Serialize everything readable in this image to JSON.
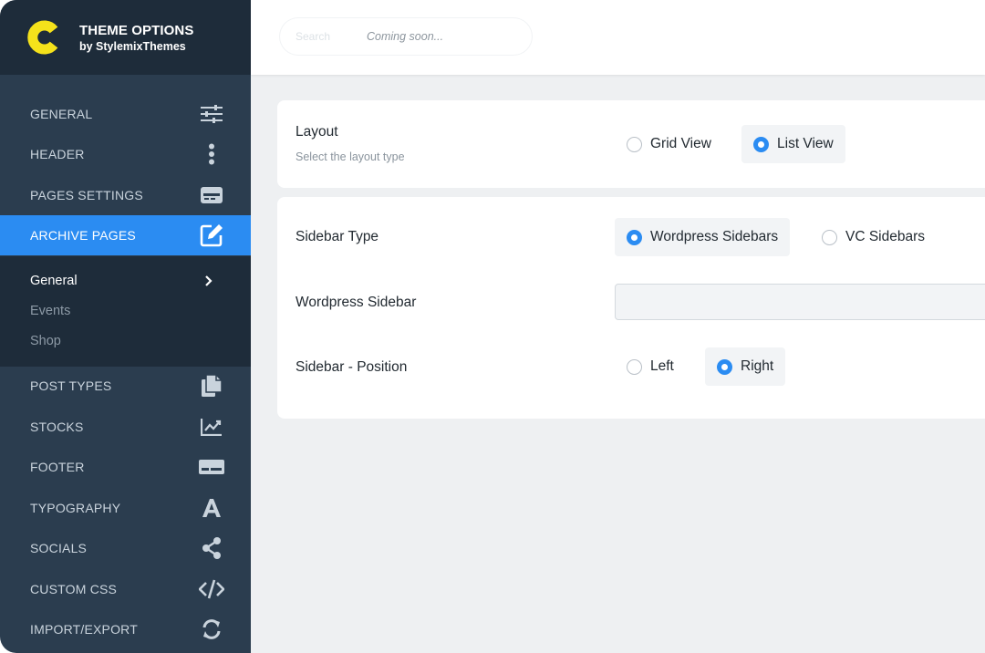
{
  "brand": {
    "title": "THEME OPTIONS",
    "subtitle": "by StylemixThemes",
    "logo_letter": "C",
    "logo_color": "#f5e21b"
  },
  "colors": {
    "accent": "#2b8cf2",
    "sidebar_bg": "#2b3d4f",
    "sidebar_dark": "#1e2c3a"
  },
  "nav": {
    "items": [
      {
        "label": "GENERAL",
        "icon": "sliders-icon"
      },
      {
        "label": "HEADER",
        "icon": "vertical-dots-icon"
      },
      {
        "label": "PAGES SETTINGS",
        "icon": "card-icon"
      },
      {
        "label": "ARCHIVE PAGES",
        "icon": "edit-icon",
        "active": true
      },
      {
        "label": "POST TYPES",
        "icon": "files-icon"
      },
      {
        "label": "STOCKS",
        "icon": "chart-icon"
      },
      {
        "label": "FOOTER",
        "icon": "footer-icon"
      },
      {
        "label": "TYPOGRAPHY",
        "icon": "letter-a-icon"
      },
      {
        "label": "SOCIALS",
        "icon": "share-icon"
      },
      {
        "label": "CUSTOM CSS",
        "icon": "code-icon"
      },
      {
        "label": "IMPORT/EXPORT",
        "icon": "refresh-icon"
      }
    ],
    "sub_items": [
      {
        "label": "General",
        "current": true
      },
      {
        "label": "Events"
      },
      {
        "label": "Shop"
      }
    ]
  },
  "search": {
    "placeholder": "Search",
    "status": "Coming soon..."
  },
  "layout_section": {
    "label": "Layout",
    "hint": "Select the layout type",
    "options": [
      "Grid View",
      "List View"
    ],
    "selected": "List View"
  },
  "sidebar_section": {
    "type_label": "Sidebar Type",
    "type_options": [
      "Wordpress Sidebars",
      "VC Sidebars"
    ],
    "type_selected": "Wordpress Sidebars",
    "wp_sidebar_label": "Wordpress Sidebar",
    "wp_sidebar_value": "",
    "position_label": "Sidebar - Position",
    "position_options": [
      "Left",
      "Right"
    ],
    "position_selected": "Right"
  }
}
